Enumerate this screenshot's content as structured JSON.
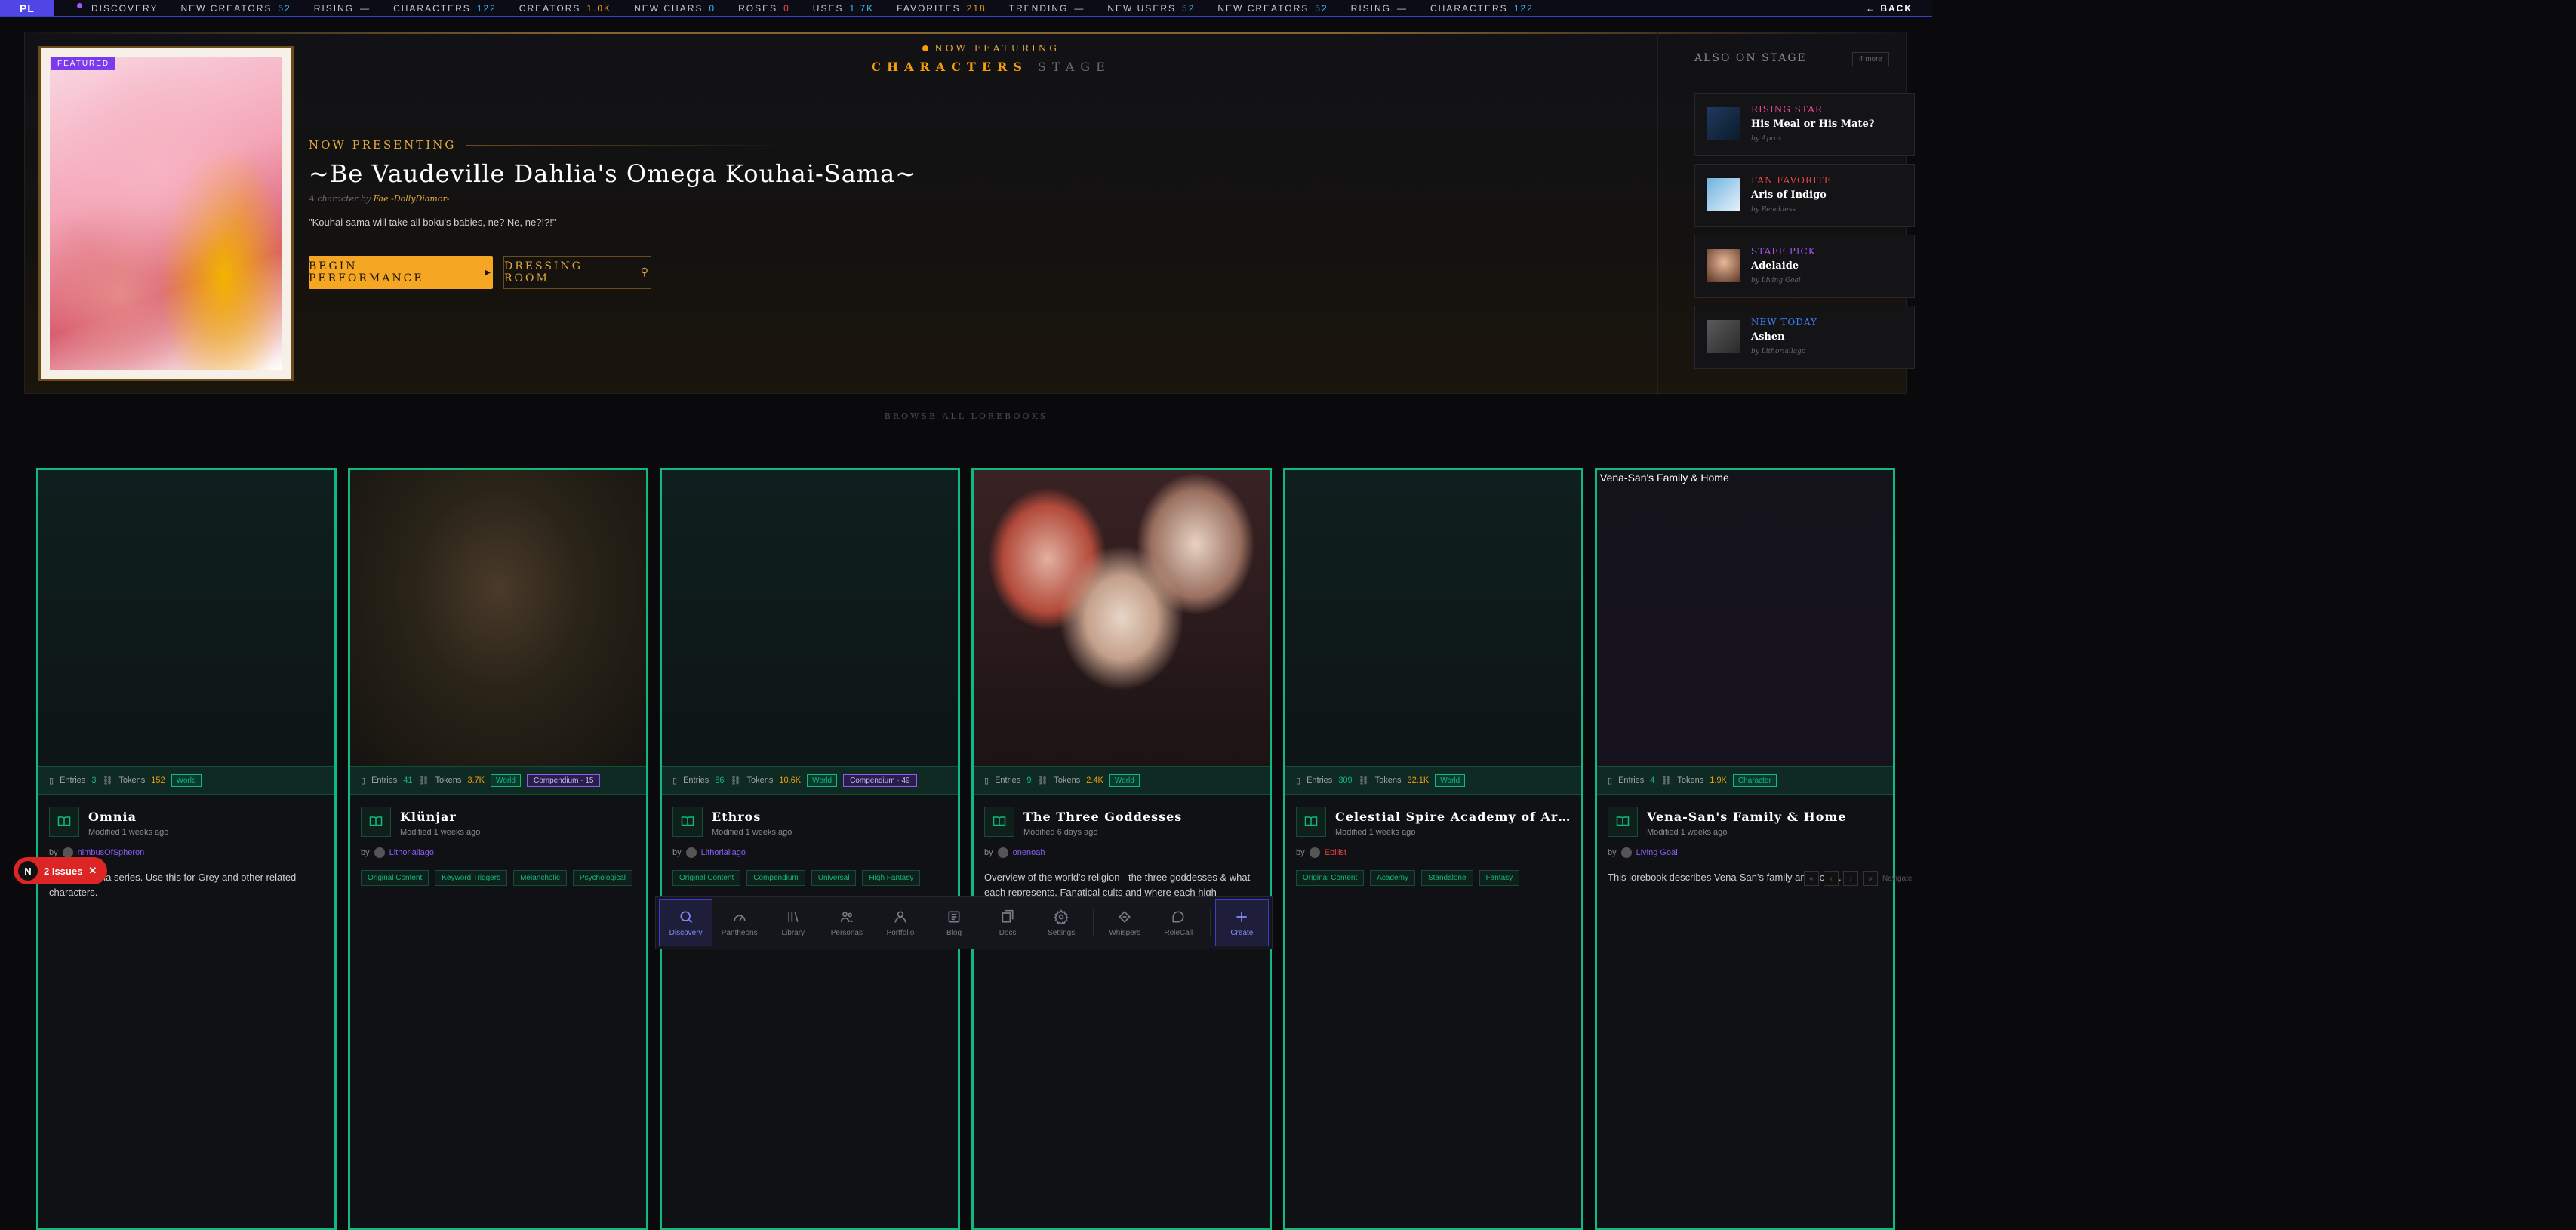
{
  "ticker": {
    "logo": "PL",
    "items": [
      {
        "label": "DISCOVERY",
        "value": "",
        "color": ""
      },
      {
        "label": "NEW CREATORS",
        "value": "52",
        "color": "blue"
      },
      {
        "label": "RISING",
        "value": "—",
        "color": ""
      },
      {
        "label": "CHARACTERS",
        "value": "122",
        "color": "blue"
      },
      {
        "label": "CREATORS",
        "value": "1.0K",
        "color": "blue"
      },
      {
        "label": "NEW CHARS",
        "value": "0",
        "color": "blue"
      },
      {
        "label": "ROSES",
        "value": "0",
        "color": "red"
      },
      {
        "label": "USES",
        "value": "1.7K",
        "color": "blue"
      },
      {
        "label": "FAVORITES",
        "value": "218",
        "color": "gold"
      },
      {
        "label": "TRENDING",
        "value": "—",
        "color": ""
      },
      {
        "label": "NEW USERS",
        "value": "52",
        "color": "blue"
      },
      {
        "label": "NEW CREATORS",
        "value": "52",
        "color": "blue"
      },
      {
        "label": "RISING",
        "value": "—",
        "color": ""
      },
      {
        "label": "CHARACTERS",
        "value": "122",
        "color": "blue"
      }
    ],
    "back": "← BACK"
  },
  "hero": {
    "badge": "FEATURED",
    "now_featuring": "NOW FEATURING",
    "stage_a": "CHARACTERS",
    "stage_b": "STAGE",
    "presenting": "NOW PRESENTING",
    "title": "~Be Vaudeville Dahlia's Omega Kouhai-Sama~",
    "by_prefix": "A character by",
    "by_author": "Fae -DollyDiamor-",
    "quote": "\"Kouhai-sama will take all boku's babies, ne? Ne, ne?!?!\"",
    "begin": "BEGIN PERFORMANCE",
    "dressing": "DRESSING ROOM"
  },
  "also": {
    "heading": "ALSO ON STAGE",
    "more": "4 more",
    "cards": [
      {
        "tag": "RISING STAR",
        "tag_color": "#ec4899",
        "name": "His Meal or His Mate?",
        "by": "by Aprox"
      },
      {
        "tag": "FAN FAVORITE",
        "tag_color": "#ef4444",
        "name": "Aris of Indigo",
        "by": "by Beackless"
      },
      {
        "tag": "STAFF PICK",
        "tag_color": "#a855f7",
        "name": "Adelaide",
        "by": "by Living Goal"
      },
      {
        "tag": "NEW TODAY",
        "tag_color": "#3b82f6",
        "name": "Ashen",
        "by": "by Lithoriallago"
      }
    ]
  },
  "browse": "BROWSE ALL LOREBOOKS",
  "lorebooks": [
    {
      "title": "Omnia",
      "entries": "3",
      "tokens": "152",
      "type": "World",
      "compendium": "",
      "modified": "Modified 1 weeks ago",
      "by": "by",
      "author": "nimbusOfSpheron",
      "author_color": "#8b5cf6",
      "tags": [],
      "desc": "For my Omnia series. Use this for Grey and other related characters."
    },
    {
      "title": "Klünjar",
      "entries": "41",
      "tokens": "3.7K",
      "type": "World",
      "compendium": "Compendium · 15",
      "modified": "Modified 1 weeks ago",
      "by": "by",
      "author": "Lithoriallago",
      "author_color": "#8b5cf6",
      "tags": [
        "Original Content",
        "Keyword Triggers",
        "Melancholic",
        "Psychological"
      ],
      "desc": ""
    },
    {
      "title": "Ethros",
      "entries": "86",
      "tokens": "10.6K",
      "type": "World",
      "compendium": "Compendium · 49",
      "modified": "Modified 1 weeks ago",
      "by": "by",
      "author": "Lithoriallago",
      "author_color": "#8b5cf6",
      "tags": [
        "Original Content",
        "Compendium",
        "Universal",
        "High Fantasy"
      ],
      "desc": ""
    },
    {
      "title": "The Three Goddesses",
      "entries": "9",
      "tokens": "2.4K",
      "type": "World",
      "compendium": "",
      "modified": "Modified 6 days ago",
      "by": "by",
      "author": "onenoah",
      "author_color": "#8b5cf6",
      "tags": [],
      "desc": "Overview of the world's religion - the three goddesses & what each represents. Fanatical cults and where each high priestess..."
    },
    {
      "title": "Celestial Spire Academy of Arcane...",
      "entries": "309",
      "tokens": "32.1K",
      "type": "World",
      "compendium": "",
      "modified": "Modified 1 weeks ago",
      "by": "by",
      "author": "Ebilist",
      "author_color": "#ef4444",
      "tags": [
        "Original Content",
        "Academy",
        "Standalone",
        "Fantasy"
      ],
      "desc": ""
    },
    {
      "title": "Vena-San's Family & Home",
      "entries": "4",
      "tokens": "1.9K",
      "type": "Character",
      "compendium": "",
      "modified": "Modified 1 weeks ago",
      "by": "by",
      "author": "Living Goal",
      "author_color": "#8b5cf6",
      "tags": [],
      "desc": "This lorebook describes Vena-San's family and home.",
      "alt": "Vena-San's Family & Home"
    }
  ],
  "dock": [
    {
      "label": "Discovery",
      "icon": "search-icon",
      "active": true
    },
    {
      "label": "Pantheons",
      "icon": "gauge-icon",
      "active": false
    },
    {
      "label": "Library",
      "icon": "library-icon",
      "active": false
    },
    {
      "label": "Personas",
      "icon": "users-icon",
      "active": false
    },
    {
      "label": "Portfolio",
      "icon": "user-icon",
      "active": false
    },
    {
      "label": "Blog",
      "icon": "newspaper-icon",
      "active": false
    },
    {
      "label": "Docs",
      "icon": "docs-icon",
      "active": false
    },
    {
      "label": "Settings",
      "icon": "gear-icon",
      "active": false
    },
    {
      "label": "Whispers",
      "icon": "whisper-icon",
      "active": false
    },
    {
      "label": "RoleCall",
      "icon": "chat-icon",
      "active": false
    },
    {
      "label": "Create",
      "icon": "plus-icon",
      "active": true
    }
  ],
  "issues": {
    "avatar": "N",
    "label": "2 Issues"
  },
  "pager": {
    "label": "Navigate"
  }
}
